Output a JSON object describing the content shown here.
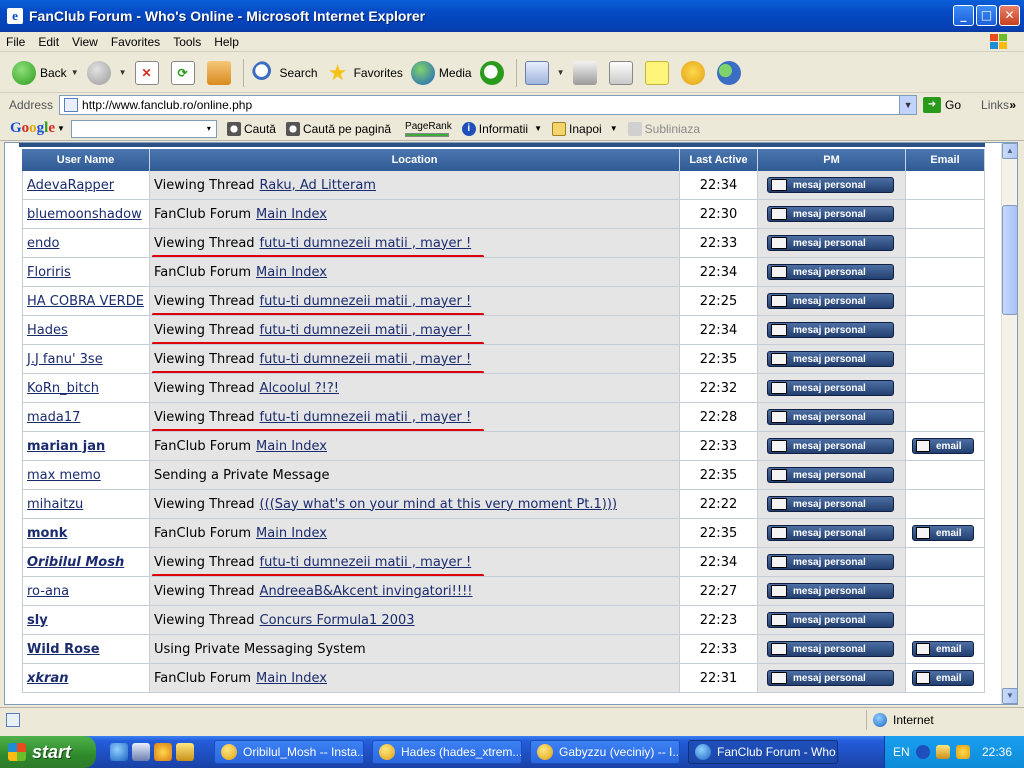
{
  "window": {
    "title": "FanClub Forum - Who's Online - Microsoft Internet Explorer",
    "app_icon_glyph": "e"
  },
  "menu": [
    "File",
    "Edit",
    "View",
    "Favorites",
    "Tools",
    "Help"
  ],
  "toolbar": {
    "back": "Back",
    "search": "Search",
    "favorites": "Favorites",
    "media": "Media"
  },
  "address": {
    "label": "Address",
    "url": "http://www.fanclub.ro/online.php",
    "go": "Go",
    "links": "Links",
    "more": "»"
  },
  "googlebar": {
    "logo": "Google",
    "search_btn": "Caută",
    "search_page_btn": "Caută pe pagină",
    "pagerank": "PageRank",
    "info": "Informatii",
    "back": "Inapoi",
    "highlight": "Subliniaza",
    "dropdown_arrow": "▾"
  },
  "table": {
    "headers": [
      "User Name",
      "Location",
      "Last Active",
      "PM",
      "Email"
    ],
    "pm_label": "mesaj personal",
    "email_label": "email",
    "rows": [
      {
        "user": "AdevaRapper",
        "style": "normal",
        "prefix": "Viewing Thread",
        "link": "Raku, Ad Litteram",
        "time": "22:34",
        "email": false,
        "red": false
      },
      {
        "user": "bluemoonshadow",
        "style": "normal",
        "prefix": "FanClub Forum",
        "link": "Main Index",
        "time": "22:30",
        "email": false,
        "red": false
      },
      {
        "user": "endo",
        "style": "normal",
        "prefix": "Viewing Thread",
        "link": "futu-ti dumnezeii matii , mayer !",
        "time": "22:33",
        "email": false,
        "red": true
      },
      {
        "user": "Floriris",
        "style": "normal",
        "prefix": "FanClub Forum",
        "link": "Main Index",
        "time": "22:34",
        "email": false,
        "red": false
      },
      {
        "user": "HA COBRA VERDE",
        "style": "normal",
        "prefix": "Viewing Thread",
        "link": "futu-ti dumnezeii matii , mayer !",
        "time": "22:25",
        "email": false,
        "red": true
      },
      {
        "user": "Hades",
        "style": "normal",
        "prefix": "Viewing Thread",
        "link": "futu-ti dumnezeii matii , mayer !",
        "time": "22:34",
        "email": false,
        "red": true
      },
      {
        "user": "J.J fanu' 3se",
        "style": "normal",
        "prefix": "Viewing Thread",
        "link": "futu-ti dumnezeii matii , mayer !",
        "time": "22:35",
        "email": false,
        "red": true
      },
      {
        "user": "KoRn_bitch",
        "style": "normal",
        "prefix": "Viewing Thread",
        "link": "Alcoolul ?!?!",
        "time": "22:32",
        "email": false,
        "red": false
      },
      {
        "user": "mada17",
        "style": "normal",
        "prefix": "Viewing Thread",
        "link": "futu-ti dumnezeii matii , mayer !",
        "time": "22:28",
        "email": false,
        "red": true
      },
      {
        "user": "marian jan",
        "style": "bold",
        "prefix": "FanClub Forum",
        "link": "Main Index",
        "time": "22:33",
        "email": true,
        "red": false
      },
      {
        "user": "max memo",
        "style": "normal",
        "prefix": "Sending a Private Message",
        "link": "",
        "time": "22:35",
        "email": false,
        "red": false
      },
      {
        "user": "mihaitzu",
        "style": "normal",
        "prefix": "Viewing Thread",
        "link": "(((Say what's on your mind at this very moment Pt.1)))",
        "time": "22:22",
        "email": false,
        "red": false
      },
      {
        "user": "monk",
        "style": "bold",
        "prefix": "FanClub Forum",
        "link": "Main Index",
        "time": "22:35",
        "email": true,
        "red": false
      },
      {
        "user": "Oribilul Mosh",
        "style": "bolditalic",
        "prefix": "Viewing Thread",
        "link": "futu-ti dumnezeii matii , mayer !",
        "time": "22:34",
        "email": false,
        "red": true
      },
      {
        "user": "ro-ana",
        "style": "normal",
        "prefix": "Viewing Thread",
        "link": "AndreeaB&Akcent invingatori!!!!",
        "time": "22:27",
        "email": false,
        "red": false
      },
      {
        "user": "sly",
        "style": "bold",
        "prefix": "Viewing Thread",
        "link": "Concurs Formula1 2003",
        "time": "22:23",
        "email": false,
        "red": false
      },
      {
        "user": "Wild Rose",
        "style": "bold",
        "prefix": "Using Private Messaging System",
        "link": "",
        "time": "22:33",
        "email": true,
        "red": false
      },
      {
        "user": "xkran",
        "style": "bolditalic",
        "prefix": "FanClub Forum",
        "link": "Main Index",
        "time": "22:31",
        "email": true,
        "red": false
      }
    ]
  },
  "statusbar": {
    "zone": "Internet"
  },
  "taskbar": {
    "start": "start",
    "tasks": [
      {
        "label": "Oribilul_Mosh -- Insta...",
        "active": false
      },
      {
        "label": "Hades (hades_xtrem...",
        "active": false
      },
      {
        "label": "Gabyzzu (veciniy) -- I...",
        "active": false
      },
      {
        "label": "FanClub Forum - Who...",
        "active": true
      }
    ],
    "lang": "EN",
    "clock": "22:36"
  },
  "colors": {
    "header_blue": "#2f5a94",
    "highlight_red": "#e0000b",
    "link_blue": "#1a2b6e"
  }
}
